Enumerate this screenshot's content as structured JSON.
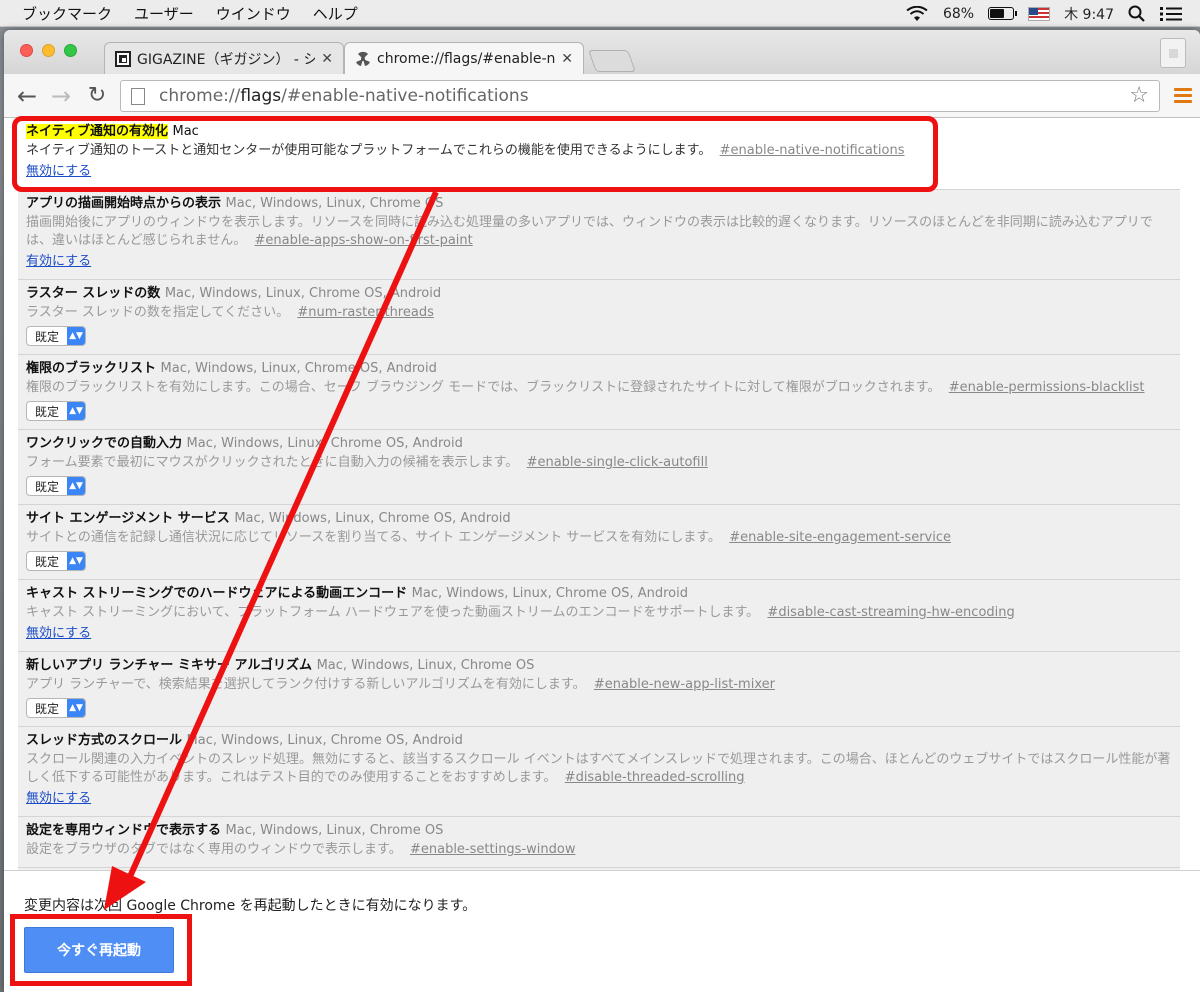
{
  "menubar": {
    "items": [
      "ブックマーク",
      "ユーザー",
      "ウインドウ",
      "ヘルプ"
    ],
    "battery": "68%",
    "clock": "木 9:47"
  },
  "tabs": [
    {
      "title": "GIGAZINE（ギガジン） - シン",
      "active": false
    },
    {
      "title": "chrome://flags/#enable-na",
      "active": true
    }
  ],
  "address": {
    "prefix": "chrome://",
    "bold": "flags",
    "suffix": "/#enable-native-notifications"
  },
  "flags": [
    {
      "title": "ネイティブ通知の有効化",
      "platforms": "Mac",
      "desc": "ネイティブ通知のトーストと通知センターが使用可能なプラットフォームでこれらの機能を使用できるようにします。",
      "anchor": "#enable-native-notifications",
      "control": "link",
      "control_label": "無効にする"
    },
    {
      "title": "アプリの描画開始時点からの表示",
      "platforms": "Mac, Windows, Linux, Chrome OS",
      "desc": "描画開始後にアプリのウィンドウを表示します。リソースを同時に読み込む処理量の多いアプリでは、ウィンドウの表示は比較的遅くなります。リソースのほとんどを非同期に読み込むアプリでは、違いはほとんど感じられません。",
      "anchor": "#enable-apps-show-on-first-paint",
      "control": "link",
      "control_label": "有効にする"
    },
    {
      "title": "ラスター スレッドの数",
      "platforms": "Mac, Windows, Linux, Chrome OS, Android",
      "desc": "ラスター スレッドの数を指定してください。",
      "anchor": "#num-raster-threads",
      "control": "select",
      "control_label": "既定"
    },
    {
      "title": "権限のブラックリスト",
      "platforms": "Mac, Windows, Linux, Chrome OS, Android",
      "desc": "権限のブラックリストを有効にします。この場合、セーフ ブラウジング モードでは、ブラックリストに登録されたサイトに対して権限がブロックされます。",
      "anchor": "#enable-permissions-blacklist",
      "control": "select",
      "control_label": "既定"
    },
    {
      "title": "ワンクリックでの自動入力",
      "platforms": "Mac, Windows, Linux, Chrome OS, Android",
      "desc": "フォーム要素で最初にマウスがクリックされたときに自動入力の候補を表示します。",
      "anchor": "#enable-single-click-autofill",
      "control": "select",
      "control_label": "既定"
    },
    {
      "title": "サイト エンゲージメント サービス",
      "platforms": "Mac, Windows, Linux, Chrome OS, Android",
      "desc": "サイトとの通信を記録し通信状況に応じてリソースを割り当てる、サイト エンゲージメント サービスを有効にします。",
      "anchor": "#enable-site-engagement-service",
      "control": "select",
      "control_label": "既定"
    },
    {
      "title": "キャスト ストリーミングでのハードウェアによる動画エンコード",
      "platforms": "Mac, Windows, Linux, Chrome OS, Android",
      "desc": "キャスト ストリーミングにおいて、プラットフォーム ハードウェアを使った動画ストリームのエンコードをサポートします。",
      "anchor": "#disable-cast-streaming-hw-encoding",
      "control": "link",
      "control_label": "無効にする"
    },
    {
      "title": "新しいアプリ ランチャー ミキサー アルゴリズム",
      "platforms": "Mac, Windows, Linux, Chrome OS",
      "desc": "アプリ ランチャーで、検索結果を選択してランク付けする新しいアルゴリズムを有効にします。",
      "anchor": "#enable-new-app-list-mixer",
      "control": "select",
      "control_label": "既定"
    },
    {
      "title": "スレッド方式のスクロール",
      "platforms": "Mac, Windows, Linux, Chrome OS, Android",
      "desc": "スクロール関連の入力イベントのスレッド処理。無効にすると、該当するスクロール イベントはすべてメインスレッドで処理されます。この場合、ほとんどのウェブサイトではスクロール性能が著しく低下する可能性があります。これはテスト目的でのみ使用することをおすすめします。",
      "anchor": "#disable-threaded-scrolling",
      "control": "link",
      "control_label": "無効にする"
    },
    {
      "title": "設定を専用ウィンドウで表示する",
      "platforms": "Mac, Windows, Linux, Chrome OS",
      "desc": "設定をブラウザのタブではなく専用のウィンドウで表示します。",
      "anchor": "#enable-settings-window",
      "control": "none",
      "control_label": ""
    }
  ],
  "footer": {
    "note": "変更内容は次回 Google Chrome を再起動したときに有効になります。",
    "restart_label": "今すぐ再起動"
  },
  "colors": {
    "annotation": "#ee1111",
    "highlight": "#ffff00",
    "link": "#1a4cc8",
    "button": "#4f8ef5",
    "menu_icon": "#e07a10"
  }
}
